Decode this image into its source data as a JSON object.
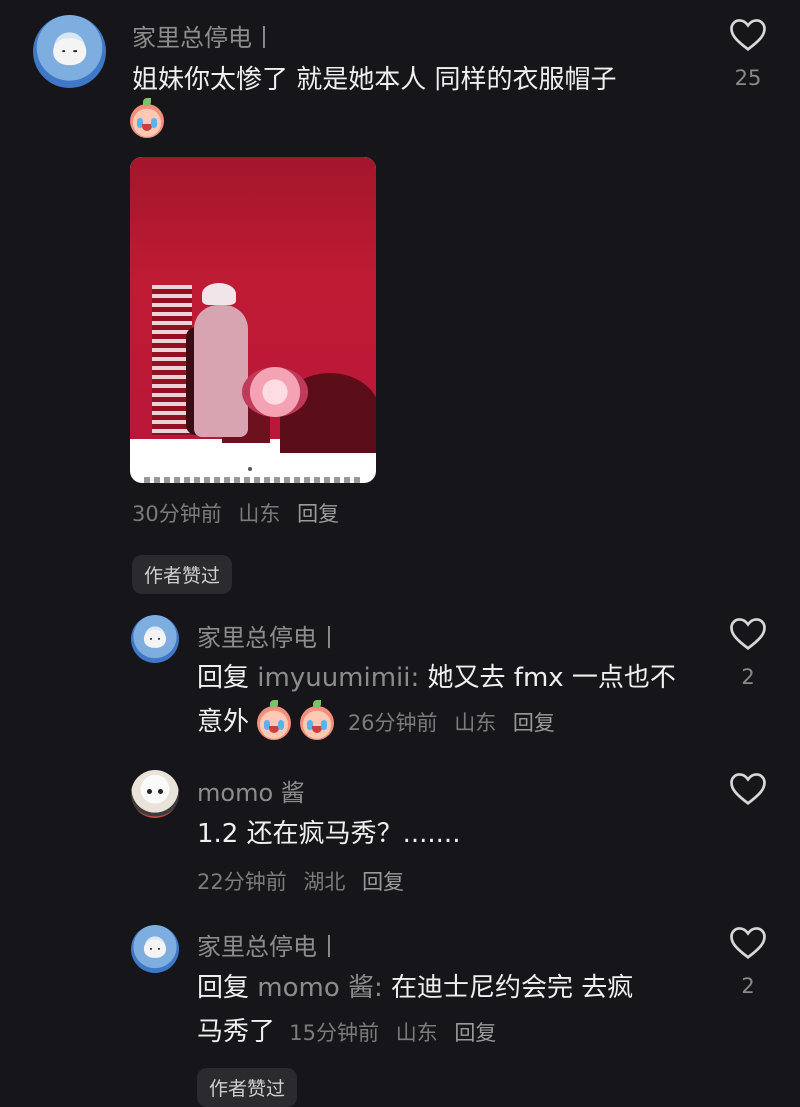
{
  "comments": [
    {
      "username": "家里总停电丨",
      "text": "姐妹你太惨了 就是她本人 同样的衣服帽子",
      "time": "30分钟前",
      "location": "山东",
      "reply_label": "回复",
      "likes": "25",
      "badge": "作者赞过"
    }
  ],
  "replies": [
    {
      "username": "家里总停电丨",
      "prefix": "回复",
      "reply_to": "imyuumimii:",
      "text_line1": "她又去 fmx 一点也不",
      "text_line2": "意外",
      "time": "26分钟前",
      "location": "山东",
      "reply_label": "回复",
      "likes": "2"
    },
    {
      "username": "momo 酱",
      "text": "1.2 还在疯马秀？.......",
      "time": "22分钟前",
      "location": "湖北",
      "reply_label": "回复",
      "likes": ""
    },
    {
      "username": "家里总停电丨",
      "prefix": "回复",
      "reply_to": "momo 酱:",
      "text_line1": "在迪士尼约会完 去疯",
      "text_line2": "马秀了",
      "time": "15分钟前",
      "location": "山东",
      "reply_label": "回复",
      "likes": "2",
      "badge": "作者赞过"
    }
  ],
  "colors": {
    "background": "#16161a",
    "text": "#efefef",
    "muted": "#7b7b7b"
  }
}
